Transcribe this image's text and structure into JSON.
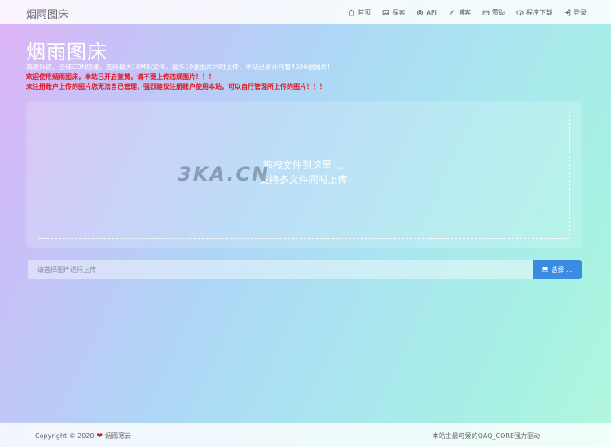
{
  "header": {
    "brand": "烟雨图床",
    "nav": [
      {
        "label": "首页",
        "icon": "home-icon"
      },
      {
        "label": "探索",
        "icon": "image-icon"
      },
      {
        "label": "API",
        "icon": "gear-icon"
      },
      {
        "label": "博客",
        "icon": "feather-icon"
      },
      {
        "label": "赞助",
        "icon": "card-icon"
      },
      {
        "label": "程序下载",
        "icon": "cloud-download-icon"
      },
      {
        "label": "登录",
        "icon": "login-icon"
      }
    ]
  },
  "hero": {
    "title": "烟雨图床",
    "line1": "高速外链、全球CDN加速，支持最大10MB/文件，最多10张图片同时上传，本站已累计托管4309张图片！",
    "line2": "欢迎使用烟雨图床，本站已开启鉴黄，请不要上传违规图片！！！",
    "line3": "未注册账户上传的图片您无法自己管理，强烈建议注册账户使用本站，可以自行管理所上传的图片！！！"
  },
  "upload": {
    "drop_line1": "拖拽文件到这里 ...",
    "drop_line2": "支持多文件同时上传",
    "placeholder": "请选择图片进行上传",
    "choose_label": "选择 ..."
  },
  "watermark": "3KA.CN",
  "footer": {
    "copyright_prefix": "Copyright © 2020",
    "copyright_owner": "烟雨寒云",
    "powered": "本站由最可爱的QAQ_CORE强力驱动"
  },
  "colors": {
    "accent": "#3b8be0",
    "warning": "#e4151b"
  }
}
